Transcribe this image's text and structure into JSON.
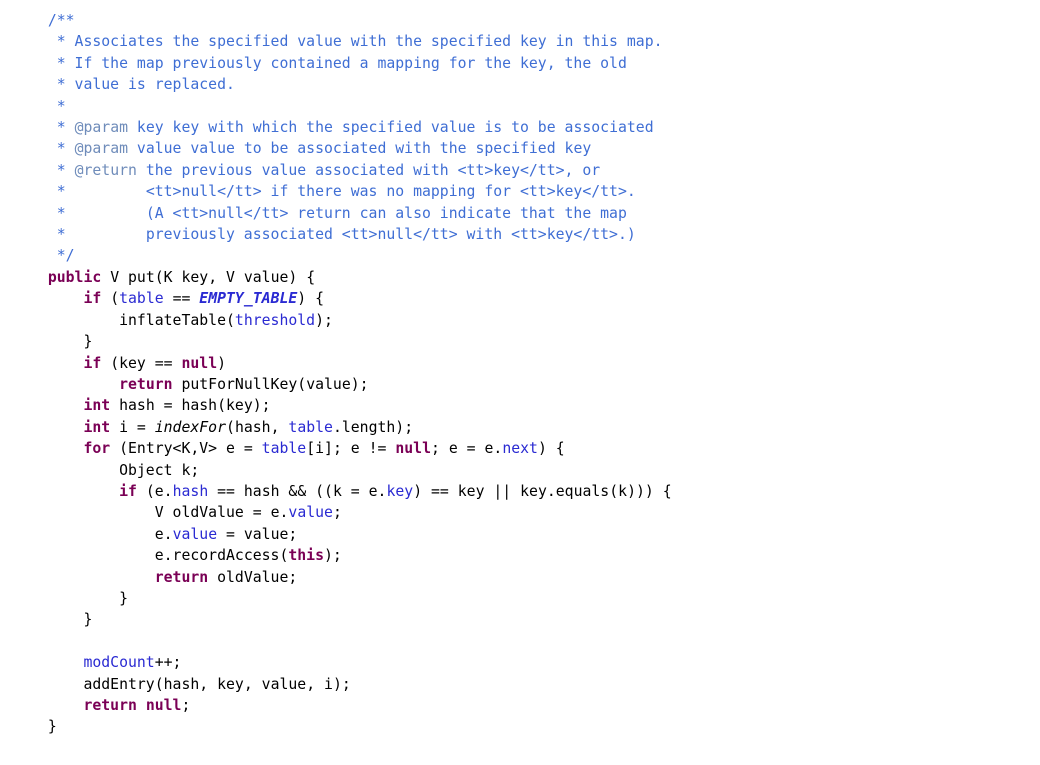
{
  "document": {
    "kind": "source-code-listing",
    "language": "Java",
    "background_color": "#ffffff",
    "font_size_px": 14.8,
    "line_height_px": 21.4
  },
  "theme": {
    "plain": "#000000",
    "keyword": "#7a0055",
    "comment": "#3f6ed4",
    "javadoc_tag": "#6f8cba",
    "field": "#2a2ad2",
    "static_field": "#2a2ad2",
    "static_method": "#000000",
    "parameter": "#92775a",
    "local_variable": "#92775a"
  },
  "lines": [
    {
      "n": 1,
      "tokens": [
        {
          "s": "  ",
          "c": "plain"
        },
        {
          "s": "/**",
          "c": "comment"
        }
      ]
    },
    {
      "n": 2,
      "tokens": [
        {
          "s": "   ",
          "c": "plain"
        },
        {
          "s": "* Associates the specified value with the specified key in this map.",
          "c": "comment"
        }
      ]
    },
    {
      "n": 3,
      "tokens": [
        {
          "s": "   ",
          "c": "plain"
        },
        {
          "s": "* If the map previously contained a mapping for the key, the old",
          "c": "comment"
        }
      ]
    },
    {
      "n": 4,
      "tokens": [
        {
          "s": "   ",
          "c": "plain"
        },
        {
          "s": "* value is replaced.",
          "c": "comment"
        }
      ]
    },
    {
      "n": 5,
      "tokens": [
        {
          "s": "   ",
          "c": "plain"
        },
        {
          "s": "*",
          "c": "comment"
        }
      ]
    },
    {
      "n": 6,
      "tokens": [
        {
          "s": "   ",
          "c": "plain"
        },
        {
          "s": "* ",
          "c": "comment"
        },
        {
          "s": "@param",
          "c": "javadoc_tag"
        },
        {
          "s": " key key with which the specified value is to be associated",
          "c": "comment"
        }
      ]
    },
    {
      "n": 7,
      "tokens": [
        {
          "s": "   ",
          "c": "plain"
        },
        {
          "s": "* ",
          "c": "comment"
        },
        {
          "s": "@param",
          "c": "javadoc_tag"
        },
        {
          "s": " value value to be associated with the specified key",
          "c": "comment"
        }
      ]
    },
    {
      "n": 8,
      "tokens": [
        {
          "s": "   ",
          "c": "plain"
        },
        {
          "s": "* ",
          "c": "comment"
        },
        {
          "s": "@return",
          "c": "javadoc_tag"
        },
        {
          "s": " the previous value associated with <tt>key</tt>, or",
          "c": "comment"
        }
      ]
    },
    {
      "n": 9,
      "tokens": [
        {
          "s": "   ",
          "c": "plain"
        },
        {
          "s": "*         <tt>null</tt> if there was no mapping for <tt>key</tt>.",
          "c": "comment"
        }
      ]
    },
    {
      "n": 10,
      "tokens": [
        {
          "s": "   ",
          "c": "plain"
        },
        {
          "s": "*         (A <tt>null</tt> return can also indicate that the map",
          "c": "comment"
        }
      ]
    },
    {
      "n": 11,
      "tokens": [
        {
          "s": "   ",
          "c": "plain"
        },
        {
          "s": "*         previously associated <tt>null</tt> with <tt>key</tt>.)",
          "c": "comment"
        }
      ]
    },
    {
      "n": 12,
      "tokens": [
        {
          "s": "   ",
          "c": "plain"
        },
        {
          "s": "*/",
          "c": "comment"
        }
      ]
    },
    {
      "n": 13,
      "tokens": [
        {
          "s": "  ",
          "c": "plain"
        },
        {
          "s": "public",
          "c": "keyword"
        },
        {
          "s": " V put(K ",
          "c": "plain"
        },
        {
          "s": "key",
          "c": "parameter"
        },
        {
          "s": ", V ",
          "c": "plain"
        },
        {
          "s": "value",
          "c": "parameter"
        },
        {
          "s": ") {",
          "c": "plain"
        }
      ]
    },
    {
      "n": 14,
      "tokens": [
        {
          "s": "      ",
          "c": "plain"
        },
        {
          "s": "if",
          "c": "keyword"
        },
        {
          "s": " (",
          "c": "plain"
        },
        {
          "s": "table",
          "c": "field"
        },
        {
          "s": " == ",
          "c": "plain"
        },
        {
          "s": "EMPTY_TABLE",
          "c": "static_field"
        },
        {
          "s": ") {",
          "c": "plain"
        }
      ]
    },
    {
      "n": 15,
      "tokens": [
        {
          "s": "          inflateTable(",
          "c": "plain"
        },
        {
          "s": "threshold",
          "c": "field"
        },
        {
          "s": ");",
          "c": "plain"
        }
      ]
    },
    {
      "n": 16,
      "tokens": [
        {
          "s": "      }",
          "c": "plain"
        }
      ]
    },
    {
      "n": 17,
      "tokens": [
        {
          "s": "      ",
          "c": "plain"
        },
        {
          "s": "if",
          "c": "keyword"
        },
        {
          "s": " (",
          "c": "plain"
        },
        {
          "s": "key",
          "c": "parameter"
        },
        {
          "s": " == ",
          "c": "plain"
        },
        {
          "s": "null",
          "c": "keyword"
        },
        {
          "s": ")",
          "c": "plain"
        }
      ]
    },
    {
      "n": 18,
      "tokens": [
        {
          "s": "          ",
          "c": "plain"
        },
        {
          "s": "return",
          "c": "keyword"
        },
        {
          "s": " putForNullKey(",
          "c": "plain"
        },
        {
          "s": "value",
          "c": "parameter"
        },
        {
          "s": ");",
          "c": "plain"
        }
      ]
    },
    {
      "n": 19,
      "tokens": [
        {
          "s": "      ",
          "c": "plain"
        },
        {
          "s": "int",
          "c": "keyword"
        },
        {
          "s": " hash = hash(",
          "c": "plain"
        },
        {
          "s": "key",
          "c": "parameter"
        },
        {
          "s": ");",
          "c": "plain"
        }
      ]
    },
    {
      "n": 20,
      "tokens": [
        {
          "s": "      ",
          "c": "plain"
        },
        {
          "s": "int",
          "c": "keyword"
        },
        {
          "s": " i = ",
          "c": "plain"
        },
        {
          "s": "indexFor",
          "c": "static_method"
        },
        {
          "s": "(",
          "c": "plain"
        },
        {
          "s": "hash",
          "c": "local_variable"
        },
        {
          "s": ", ",
          "c": "plain"
        },
        {
          "s": "table",
          "c": "field"
        },
        {
          "s": ".length);",
          "c": "plain"
        }
      ]
    },
    {
      "n": 21,
      "tokens": [
        {
          "s": "      ",
          "c": "plain"
        },
        {
          "s": "for",
          "c": "keyword"
        },
        {
          "s": " (Entry<K,V> ",
          "c": "plain"
        },
        {
          "s": "e",
          "c": "local_variable"
        },
        {
          "s": " = ",
          "c": "plain"
        },
        {
          "s": "table",
          "c": "field"
        },
        {
          "s": "[",
          "c": "plain"
        },
        {
          "s": "i",
          "c": "local_variable"
        },
        {
          "s": "]; ",
          "c": "plain"
        },
        {
          "s": "e",
          "c": "local_variable"
        },
        {
          "s": " != ",
          "c": "plain"
        },
        {
          "s": "null",
          "c": "keyword"
        },
        {
          "s": "; ",
          "c": "plain"
        },
        {
          "s": "e",
          "c": "local_variable"
        },
        {
          "s": " = ",
          "c": "plain"
        },
        {
          "s": "e",
          "c": "local_variable"
        },
        {
          "s": ".",
          "c": "plain"
        },
        {
          "s": "next",
          "c": "field"
        },
        {
          "s": ") {",
          "c": "plain"
        }
      ]
    },
    {
      "n": 22,
      "tokens": [
        {
          "s": "          Object ",
          "c": "plain"
        },
        {
          "s": "k",
          "c": "local_variable"
        },
        {
          "s": ";",
          "c": "plain"
        }
      ]
    },
    {
      "n": 23,
      "tokens": [
        {
          "s": "          ",
          "c": "plain"
        },
        {
          "s": "if",
          "c": "keyword"
        },
        {
          "s": " (",
          "c": "plain"
        },
        {
          "s": "e",
          "c": "local_variable"
        },
        {
          "s": ".",
          "c": "plain"
        },
        {
          "s": "hash",
          "c": "field"
        },
        {
          "s": " == ",
          "c": "plain"
        },
        {
          "s": "hash",
          "c": "local_variable"
        },
        {
          "s": " && ((",
          "c": "plain"
        },
        {
          "s": "k",
          "c": "local_variable"
        },
        {
          "s": " = ",
          "c": "plain"
        },
        {
          "s": "e",
          "c": "local_variable"
        },
        {
          "s": ".",
          "c": "plain"
        },
        {
          "s": "key",
          "c": "field"
        },
        {
          "s": ") == ",
          "c": "plain"
        },
        {
          "s": "key",
          "c": "parameter"
        },
        {
          "s": " || ",
          "c": "plain"
        },
        {
          "s": "key",
          "c": "parameter"
        },
        {
          "s": ".equals(",
          "c": "plain"
        },
        {
          "s": "k",
          "c": "local_variable"
        },
        {
          "s": "))) {",
          "c": "plain"
        }
      ]
    },
    {
      "n": 24,
      "tokens": [
        {
          "s": "              V ",
          "c": "plain"
        },
        {
          "s": "oldValue",
          "c": "local_variable"
        },
        {
          "s": " = ",
          "c": "plain"
        },
        {
          "s": "e",
          "c": "local_variable"
        },
        {
          "s": ".",
          "c": "plain"
        },
        {
          "s": "value",
          "c": "field"
        },
        {
          "s": ";",
          "c": "plain"
        }
      ]
    },
    {
      "n": 25,
      "tokens": [
        {
          "s": "              ",
          "c": "plain"
        },
        {
          "s": "e",
          "c": "local_variable"
        },
        {
          "s": ".",
          "c": "plain"
        },
        {
          "s": "value",
          "c": "field"
        },
        {
          "s": " = ",
          "c": "plain"
        },
        {
          "s": "value",
          "c": "parameter"
        },
        {
          "s": ";",
          "c": "plain"
        }
      ]
    },
    {
      "n": 26,
      "tokens": [
        {
          "s": "              ",
          "c": "plain"
        },
        {
          "s": "e",
          "c": "local_variable"
        },
        {
          "s": ".recordAccess(",
          "c": "plain"
        },
        {
          "s": "this",
          "c": "keyword"
        },
        {
          "s": ");",
          "c": "plain"
        }
      ]
    },
    {
      "n": 27,
      "tokens": [
        {
          "s": "              ",
          "c": "plain"
        },
        {
          "s": "return",
          "c": "keyword"
        },
        {
          "s": " ",
          "c": "plain"
        },
        {
          "s": "oldValue",
          "c": "local_variable"
        },
        {
          "s": ";",
          "c": "plain"
        }
      ]
    },
    {
      "n": 28,
      "tokens": [
        {
          "s": "          }",
          "c": "plain"
        }
      ]
    },
    {
      "n": 29,
      "tokens": [
        {
          "s": "      }",
          "c": "plain"
        }
      ]
    },
    {
      "n": 30,
      "tokens": [
        {
          "s": "",
          "c": "plain"
        }
      ]
    },
    {
      "n": 31,
      "tokens": [
        {
          "s": "      ",
          "c": "plain"
        },
        {
          "s": "modCount",
          "c": "field"
        },
        {
          "s": "++;",
          "c": "plain"
        }
      ]
    },
    {
      "n": 32,
      "tokens": [
        {
          "s": "      addEntry(",
          "c": "plain"
        },
        {
          "s": "hash",
          "c": "local_variable"
        },
        {
          "s": ", ",
          "c": "plain"
        },
        {
          "s": "key",
          "c": "parameter"
        },
        {
          "s": ", ",
          "c": "plain"
        },
        {
          "s": "value",
          "c": "parameter"
        },
        {
          "s": ", ",
          "c": "plain"
        },
        {
          "s": "i",
          "c": "local_variable"
        },
        {
          "s": ");",
          "c": "plain"
        }
      ]
    },
    {
      "n": 33,
      "tokens": [
        {
          "s": "      ",
          "c": "plain"
        },
        {
          "s": "return",
          "c": "keyword"
        },
        {
          "s": " ",
          "c": "plain"
        },
        {
          "s": "null",
          "c": "keyword"
        },
        {
          "s": ";",
          "c": "plain"
        }
      ]
    },
    {
      "n": 34,
      "tokens": [
        {
          "s": "  }",
          "c": "plain"
        }
      ]
    }
  ]
}
